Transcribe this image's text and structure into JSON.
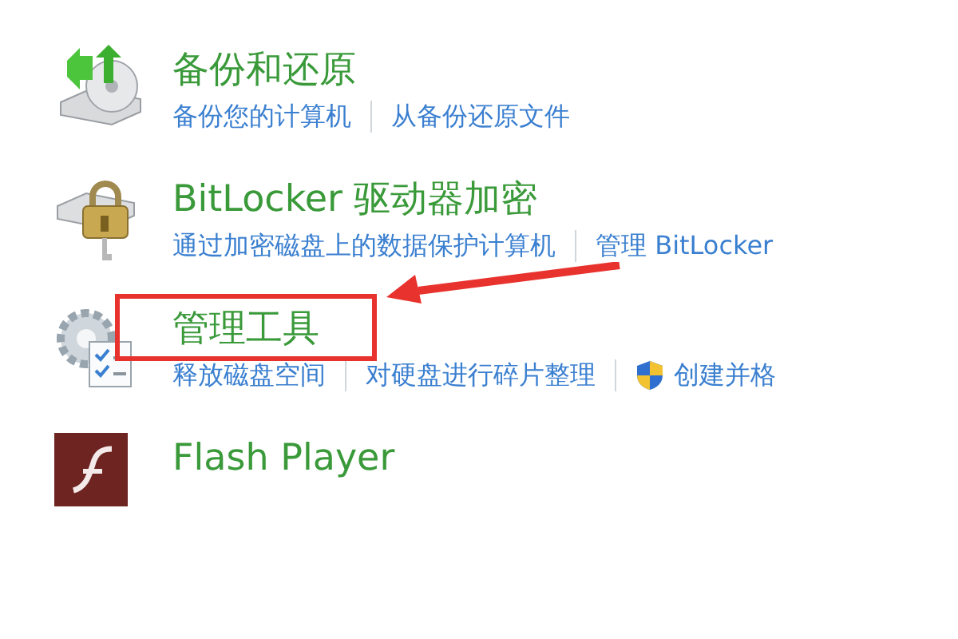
{
  "items": [
    {
      "kind": "backup",
      "title": "备份和还原",
      "highlighted": false,
      "links": [
        {
          "label": "备份您的计算机",
          "shield": false
        },
        {
          "label": "从备份还原文件",
          "shield": false
        }
      ]
    },
    {
      "kind": "bitlocker",
      "title": "BitLocker 驱动器加密",
      "highlighted": false,
      "links": [
        {
          "label": "通过加密磁盘上的数据保护计算机",
          "shield": false
        },
        {
          "label": "管理 BitLocker",
          "shield": false
        }
      ]
    },
    {
      "kind": "admin",
      "title": "管理工具",
      "highlighted": true,
      "links": [
        {
          "label": "释放磁盘空间",
          "shield": false
        },
        {
          "label": "对硬盘进行碎片整理",
          "shield": false
        },
        {
          "label": "创建并格",
          "shield": true
        }
      ]
    },
    {
      "kind": "flash",
      "title": "Flash Player",
      "highlighted": false
    }
  ]
}
